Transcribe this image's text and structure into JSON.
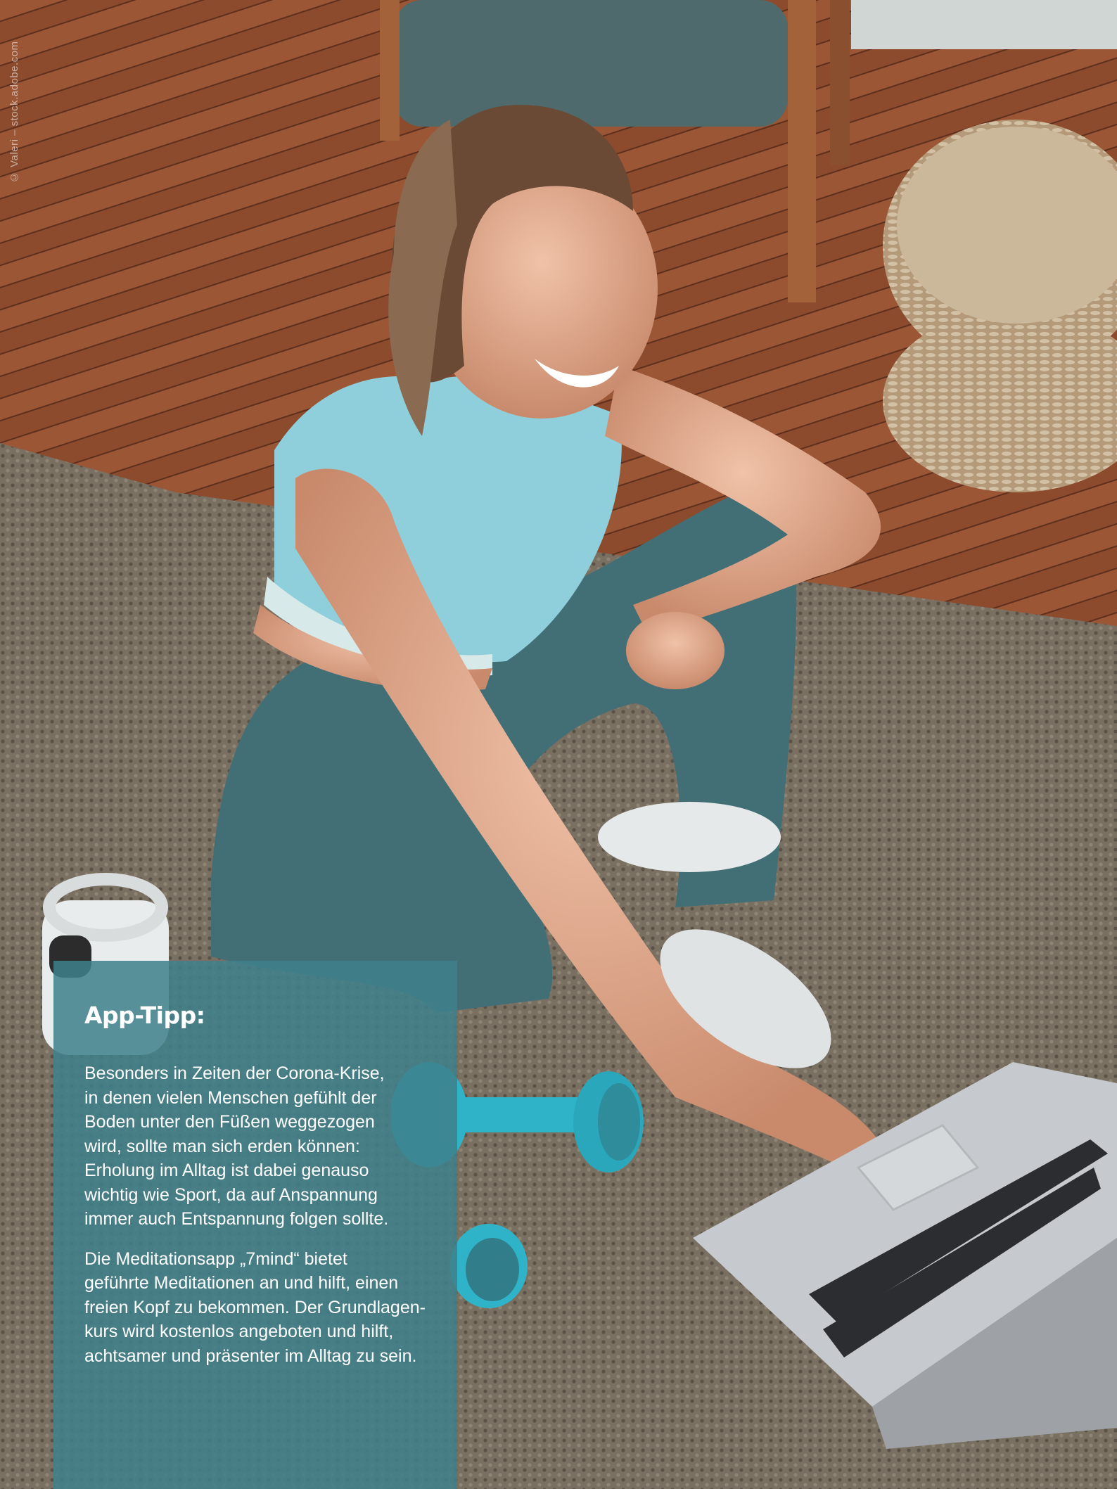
{
  "photo": {
    "credit": "© Valeri – stock.adobe.com",
    "colors": {
      "wood_floor": "#8a4a2c",
      "rug": "#7d7466",
      "top": "#8fcfdb",
      "leggings": "#3f6f76",
      "dumbbell": "#2fb3c9",
      "laptop": "#c9cbcf"
    }
  },
  "tip": {
    "title": "App-Tipp:",
    "paragraph1_lines": [
      "Besonders in Zeiten der Corona-Krise,",
      "in denen vielen Menschen gefühlt der",
      "Boden unter den Füßen weggezogen",
      "wird, sollte man sich erden können:",
      "Erholung im Alltag ist dabei genauso",
      "wichtig wie Sport, da auf Anspannung",
      "immer auch Entspannung folgen sollte."
    ],
    "paragraph2_lines": [
      "Die Meditationsapp „7mind“ bietet",
      "geführte Meditationen an und hilft, einen",
      "freien Kopf zu bekommen. Der Grundlagen-",
      "kurs wird kostenlos angeboten und hilft,",
      "achtsamer und präsenter im Alltag zu sein."
    ],
    "panel_color": "#3f808a"
  }
}
